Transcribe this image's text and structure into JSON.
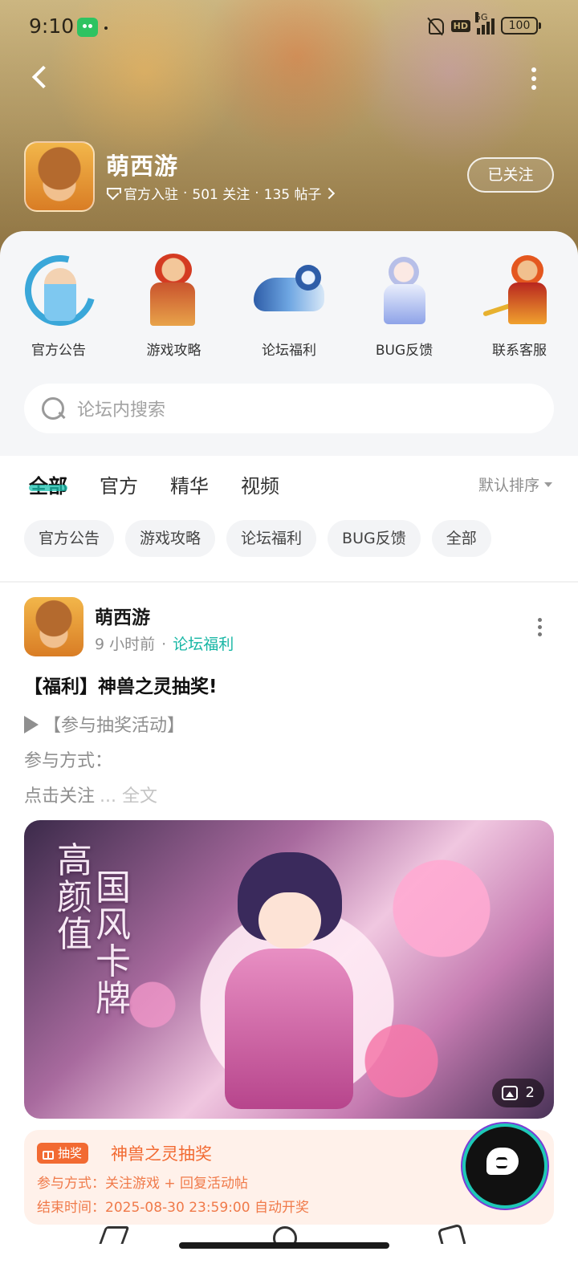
{
  "status_bar": {
    "time": "9:10",
    "network": "5G",
    "hd": "HD",
    "battery": "100"
  },
  "nav": {
    "back_icon": "back-arrow-icon",
    "more_icon": "more-vertical-icon"
  },
  "game": {
    "name": "萌西游",
    "meta": {
      "official": "官方入驻",
      "followers": "501 关注",
      "posts": "135 帖子"
    },
    "follow_label": "已关注"
  },
  "categories": [
    {
      "label": "官方公告",
      "icon": "character-announcement"
    },
    {
      "label": "游戏攻略",
      "icon": "character-guide"
    },
    {
      "label": "论坛福利",
      "icon": "character-welfare"
    },
    {
      "label": "BUG反馈",
      "icon": "character-bug"
    },
    {
      "label": "联系客服",
      "icon": "character-support"
    }
  ],
  "search": {
    "placeholder": "论坛内搜索"
  },
  "tabs": [
    {
      "label": "全部",
      "active": true
    },
    {
      "label": "官方",
      "active": false
    },
    {
      "label": "精华",
      "active": false
    },
    {
      "label": "视频",
      "active": false
    }
  ],
  "sort_label": "默认排序",
  "chips": [
    "官方公告",
    "游戏攻略",
    "论坛福利",
    "BUG反馈",
    "全部"
  ],
  "post": {
    "author": "萌西游",
    "time": "9 小时前",
    "board": "论坛福利",
    "title": "【福利】神兽之灵抽奖!",
    "line1": "【参与抽奖活动】",
    "line2": "参与方式：",
    "line3": "点击关注",
    "more_label": "... 全文",
    "image": {
      "text_left": "高颜值",
      "text_right": "国风卡牌",
      "count": "2"
    },
    "lottery": {
      "tag": "抽奖",
      "title": "神兽之灵抽奖",
      "method": "参与方式：关注游戏 + 回复活动帖",
      "end_time": "结束时间：2025-08-30 23:59:00 自动开奖"
    }
  },
  "colors": {
    "accent": "#19c2b0",
    "board_link": "#17b6a4",
    "lottery_orange": "#f26a32",
    "lottery_bg": "#fff1ea"
  }
}
